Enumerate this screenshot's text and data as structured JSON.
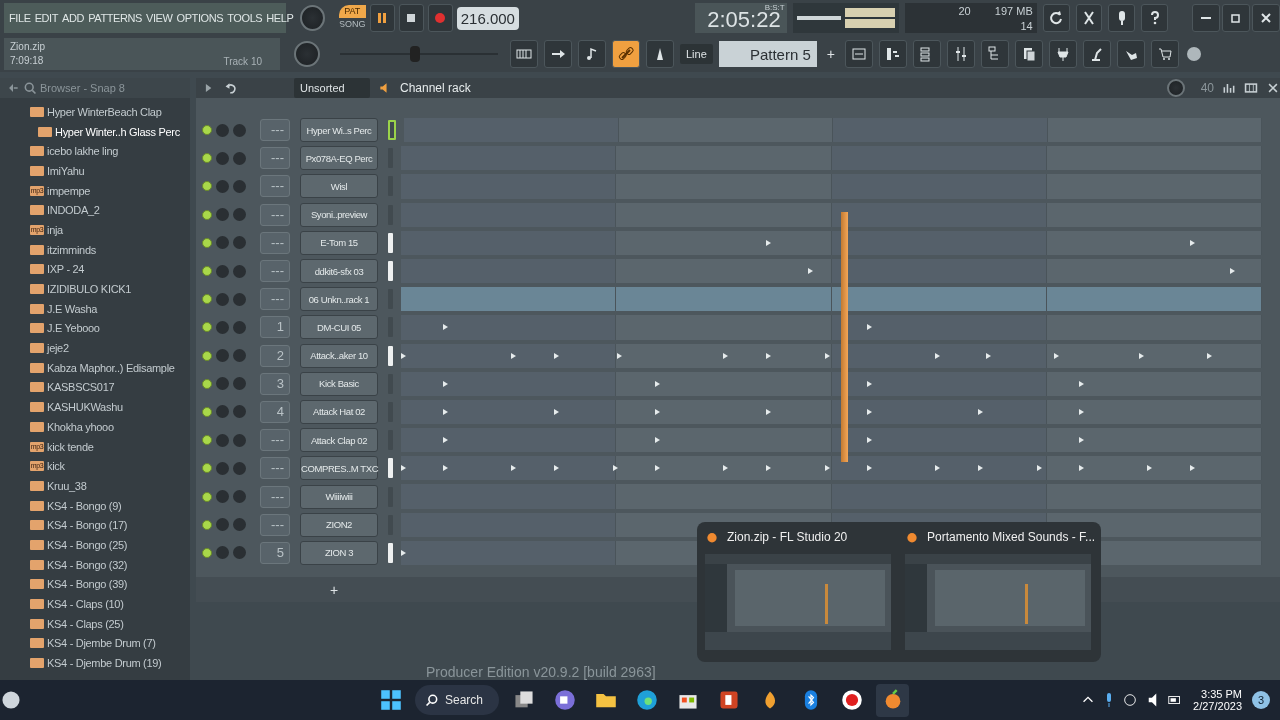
{
  "menu": [
    "FILE",
    "EDIT",
    "ADD",
    "PATTERNS",
    "VIEW",
    "OPTIONS",
    "TOOLS",
    "HELP"
  ],
  "hint": {
    "title": "Zion.zip",
    "time": "7:09:18",
    "track": "Track 10"
  },
  "transport": {
    "modes": [
      {
        "label": "PAT",
        "selected": true
      },
      {
        "label": "SONG",
        "selected": false
      }
    ],
    "playing": true,
    "tempo": "216.000"
  },
  "clock": {
    "time": "2:05:22",
    "format": "B:S:T"
  },
  "monitor": {
    "cpu": "20",
    "memory": "197 MB",
    "polyphony": "14"
  },
  "pitch": {
    "level": 0.5
  },
  "snap": "Line",
  "pattern": {
    "name": "Pattern 5",
    "add": "+"
  },
  "browser": {
    "title": "Browser - Snap 8",
    "items": [
      {
        "label": "Hyper WinterBeach Clap",
        "selected": false,
        "children": [
          {
            "label": "Hyper Winter..h Glass Perc",
            "selected": true
          }
        ]
      },
      {
        "label": "icebo lakhe ling",
        "selected": false
      },
      {
        "label": "ImiYahu",
        "selected": false
      },
      {
        "label": "impempe",
        "badge": "mp3",
        "selected": false
      },
      {
        "label": "INDODA_2",
        "selected": false
      },
      {
        "label": "inja",
        "badge": "mp3",
        "selected": false
      },
      {
        "label": "itzimminds",
        "selected": false
      },
      {
        "label": "IXP - 24",
        "selected": false
      },
      {
        "label": "IZIDIBULO KICK1",
        "selected": false
      },
      {
        "label": "J.E Washa",
        "selected": false
      },
      {
        "label": "J.E Yebooo",
        "selected": false
      },
      {
        "label": "jeje2",
        "selected": false
      },
      {
        "label": "Kabza Maphor..) Edisample",
        "selected": false
      },
      {
        "label": "KASBSCS017",
        "selected": false
      },
      {
        "label": "KASHUKWashu",
        "selected": false
      },
      {
        "label": "Khokha yhooo",
        "selected": false
      },
      {
        "label": "kick tende",
        "badge": "mp3",
        "selected": false
      },
      {
        "label": "kick",
        "badge": "mp3",
        "selected": false
      },
      {
        "label": "Kruu_38",
        "selected": false
      },
      {
        "label": "KS4 - Bongo (9)",
        "selected": false
      },
      {
        "label": "KS4 - Bongo (17)",
        "selected": false
      },
      {
        "label": "KS4 - Bongo (25)",
        "selected": false
      },
      {
        "label": "KS4 - Bongo (32)",
        "selected": false
      },
      {
        "label": "KS4 - Bongo (39)",
        "selected": false
      },
      {
        "label": "KS4 - Claps (10)",
        "selected": false
      },
      {
        "label": "KS4 - Claps (25)",
        "selected": false
      },
      {
        "label": "KS4 - Djembe Drum (7)",
        "selected": false
      },
      {
        "label": "KS4 - Djembe Drum (19)",
        "selected": false
      }
    ]
  },
  "rack": {
    "filter": "Unsorted",
    "title": "Channel rack",
    "swing": "40",
    "add": "+",
    "channels": [
      {
        "name": "Hyper Wi..s Perc",
        "track": "---",
        "selected": true,
        "lit": false,
        "highlighted": false
      },
      {
        "name": "Px078A-EQ Perc",
        "track": "---",
        "selected": false,
        "lit": false,
        "highlighted": false
      },
      {
        "name": "Wisl",
        "track": "---",
        "selected": false,
        "lit": false,
        "highlighted": false
      },
      {
        "name": "Syoni..preview",
        "track": "---",
        "selected": false,
        "lit": false,
        "highlighted": false
      },
      {
        "name": "E-Tom 15",
        "track": "---",
        "selected": false,
        "lit": true,
        "highlighted": false
      },
      {
        "name": "ddkit6-sfx 03",
        "track": "---",
        "selected": false,
        "lit": true,
        "highlighted": false
      },
      {
        "name": "06 Unkn..rack 1",
        "track": "---",
        "selected": false,
        "lit": false,
        "highlighted": true
      },
      {
        "name": "DM-CUI 05",
        "track": "1",
        "selected": false,
        "lit": false,
        "highlighted": false
      },
      {
        "name": "Attack..aker 10",
        "track": "2",
        "selected": false,
        "lit": true,
        "highlighted": false
      },
      {
        "name": "Kick Basic",
        "track": "3",
        "selected": false,
        "lit": false,
        "highlighted": false
      },
      {
        "name": "Attack Hat 02",
        "track": "4",
        "selected": false,
        "lit": false,
        "highlighted": false
      },
      {
        "name": "Attack Clap 02",
        "track": "---",
        "selected": false,
        "lit": false,
        "highlighted": false
      },
      {
        "name": "COMPRES..M TXC",
        "track": "---",
        "selected": false,
        "lit": true,
        "highlighted": false
      },
      {
        "name": "Wiiiiwiii",
        "track": "---",
        "selected": false,
        "lit": false,
        "highlighted": false
      },
      {
        "name": "ZION2",
        "track": "---",
        "selected": false,
        "lit": false,
        "highlighted": false
      },
      {
        "name": "ZION 3",
        "track": "5",
        "selected": false,
        "lit": true,
        "highlighted": false
      }
    ]
  },
  "status": "Producer Edition v20.9.2 [build 2963]",
  "preview": {
    "windows": [
      {
        "title": "Zion.zip - FL Studio 20"
      },
      {
        "title": "Portamento Mixed Sounds - F..."
      }
    ]
  },
  "taskbar": {
    "search": "Search",
    "time": "3:35 PM",
    "date": "2/27/2023",
    "notifications": "3"
  }
}
